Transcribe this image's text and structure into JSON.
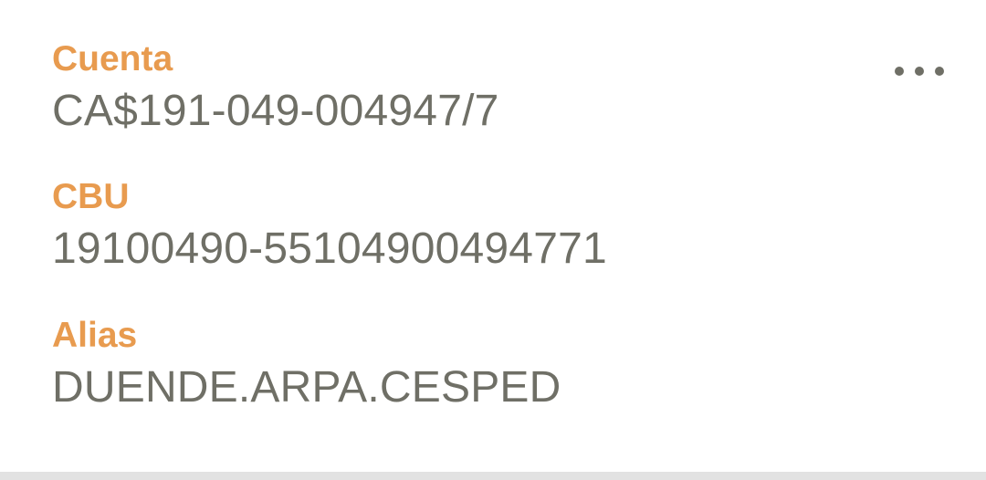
{
  "account": {
    "fields": [
      {
        "label": "Cuenta",
        "value": "CA$191-049-004947/7"
      },
      {
        "label": "CBU",
        "value": "19100490-55104900494771"
      },
      {
        "label": "Alias",
        "value": "DUENDE.ARPA.CESPED"
      }
    ],
    "menu_icon": "more-horizontal-icon"
  },
  "colors": {
    "label": "#e89b4f",
    "value": "#6f6f66",
    "icon": "#6f6f66",
    "divider": "#e2e2e2"
  }
}
